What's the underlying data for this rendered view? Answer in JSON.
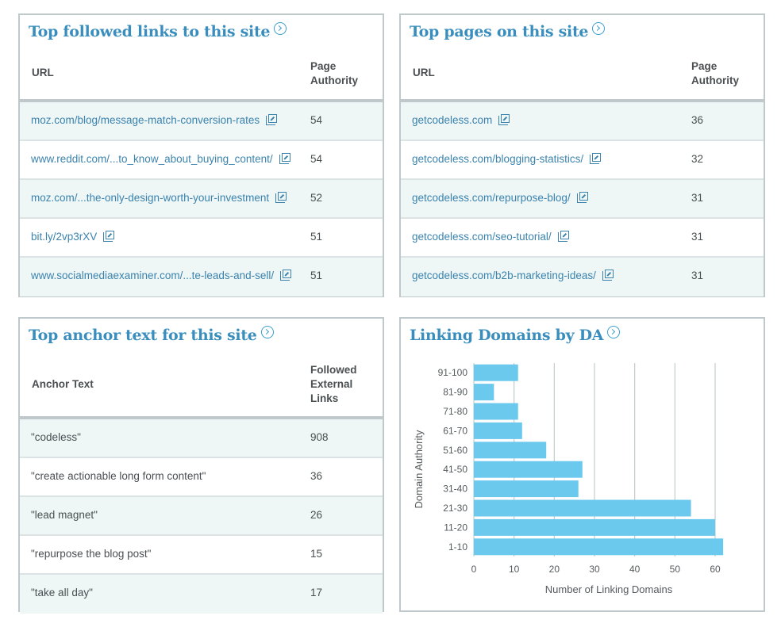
{
  "top_links": {
    "title": "Top followed links to this site",
    "columns": [
      "URL",
      "Page\nAuthority"
    ],
    "col_url": "URL",
    "col_pa_line1": "Page",
    "col_pa_line2": "Authority",
    "rows": [
      {
        "url": "moz.com/blog/message-match-conversion-rates",
        "pa": "54"
      },
      {
        "url": "www.reddit.com/...to_know_about_buying_content/",
        "pa": "54"
      },
      {
        "url": "moz.com/...the-only-design-worth-your-investment",
        "pa": "52"
      },
      {
        "url": "bit.ly/2vp3rXV",
        "pa": "51"
      },
      {
        "url": "www.socialmediaexaminer.com/...te-leads-and-sell/",
        "pa": "51"
      }
    ]
  },
  "top_pages": {
    "title": "Top pages on this site",
    "col_url": "URL",
    "col_pa_line1": "Page",
    "col_pa_line2": "Authority",
    "rows": [
      {
        "url": "getcodeless.com",
        "pa": "36"
      },
      {
        "url": "getcodeless.com/blogging-statistics/",
        "pa": "32"
      },
      {
        "url": "getcodeless.com/repurpose-blog/",
        "pa": "31"
      },
      {
        "url": "getcodeless.com/seo-tutorial/",
        "pa": "31"
      },
      {
        "url": "getcodeless.com/b2b-marketing-ideas/",
        "pa": "31"
      }
    ]
  },
  "top_anchor": {
    "title": "Top anchor text for this site",
    "col_text": "Anchor Text",
    "col_links_line1": "Followed",
    "col_links_line2": "External",
    "col_links_line3": "Links",
    "rows": [
      {
        "text": "\"codeless\"",
        "links": "908"
      },
      {
        "text": "\"create actionable long form content\"",
        "links": "36"
      },
      {
        "text": "\"lead magnet\"",
        "links": "26"
      },
      {
        "text": "\"repurpose the blog post\"",
        "links": "15"
      },
      {
        "text": "\"take all day\"",
        "links": "17"
      }
    ]
  },
  "linking_domains": {
    "title": "Linking Domains by DA"
  },
  "colors": {
    "accent": "#3a8ebd",
    "bar": "#6bc9ee",
    "border": "#bfc8ca",
    "row_alt": "#eef6f6"
  },
  "chart_data": {
    "type": "bar",
    "orientation": "horizontal",
    "title": "Linking Domains by DA",
    "xlabel": "Number of Linking Domains",
    "ylabel": "Domain Authority",
    "categories": [
      "91-100",
      "81-90",
      "71-80",
      "61-70",
      "51-60",
      "41-50",
      "31-40",
      "21-30",
      "11-20",
      "1-10"
    ],
    "values": [
      11,
      5,
      11,
      12,
      18,
      27,
      26,
      54,
      60,
      62
    ],
    "xlim": [
      0,
      62
    ],
    "xticks": [
      0,
      10,
      20,
      30,
      40,
      50,
      60
    ],
    "grid": true,
    "legend": "none"
  }
}
